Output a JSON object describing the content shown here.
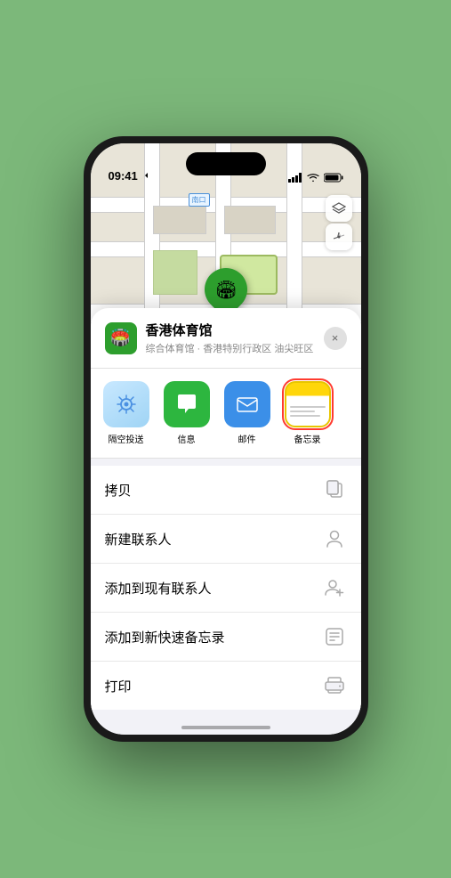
{
  "status_bar": {
    "time": "09:41",
    "nav_icon": "▶"
  },
  "map": {
    "label_entrance": "南口"
  },
  "location": {
    "name": "香港体育馆",
    "subtitle": "综合体育馆 · 香港特别行政区 油尖旺区",
    "icon": "🏟️"
  },
  "share_apps": [
    {
      "id": "airdrop",
      "label": "隔空投送",
      "type": "airdrop"
    },
    {
      "id": "messages",
      "label": "信息",
      "type": "messages"
    },
    {
      "id": "mail",
      "label": "邮件",
      "type": "mail"
    },
    {
      "id": "notes",
      "label": "备忘录",
      "type": "notes",
      "selected": true
    }
  ],
  "actions": [
    {
      "id": "copy",
      "label": "拷贝",
      "icon": "copy"
    },
    {
      "id": "new-contact",
      "label": "新建联系人",
      "icon": "person"
    },
    {
      "id": "add-contact",
      "label": "添加到现有联系人",
      "icon": "person-add"
    },
    {
      "id": "add-note",
      "label": "添加到新快速备忘录",
      "icon": "note"
    },
    {
      "id": "print",
      "label": "打印",
      "icon": "print"
    }
  ],
  "close_label": "×",
  "colors": {
    "green": "#2d9e2d",
    "red": "#ff3b30",
    "blue": "#3b8fe8"
  }
}
